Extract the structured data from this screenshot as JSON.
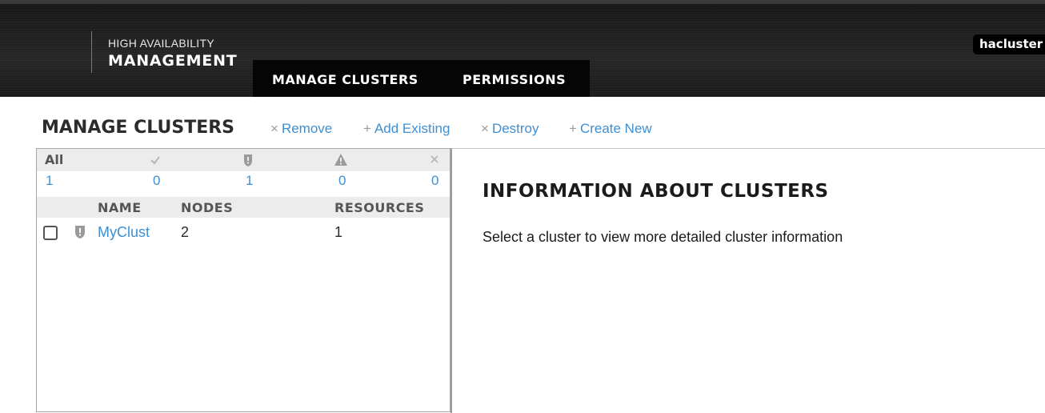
{
  "header": {
    "brand_line1": "HIGH AVAILABILITY",
    "brand_line2": "MANAGEMENT",
    "nav_tabs": [
      {
        "label": "MANAGE CLUSTERS",
        "active": true
      },
      {
        "label": "PERMISSIONS",
        "active": false
      }
    ],
    "user": "hacluster"
  },
  "toolbar": {
    "title": "MANAGE CLUSTERS",
    "actions": [
      {
        "label": "Remove",
        "glyph": "×",
        "icon": "remove-icon"
      },
      {
        "label": "Add Existing",
        "glyph": "+",
        "icon": "plus-icon"
      },
      {
        "label": "Destroy",
        "glyph": "×",
        "icon": "remove-icon"
      },
      {
        "label": "Create New",
        "glyph": "+",
        "icon": "plus-icon"
      }
    ]
  },
  "cluster_list": {
    "filters": [
      {
        "label": "All",
        "count": "1",
        "icon": null
      },
      {
        "label": "",
        "count": "0",
        "icon": "check-icon"
      },
      {
        "label": "",
        "count": "1",
        "icon": "shield-icon"
      },
      {
        "label": "",
        "count": "0",
        "icon": "warning-icon"
      },
      {
        "label": "",
        "count": "0",
        "icon": "error-x-icon"
      }
    ],
    "columns": [
      "NAME",
      "NODES",
      "RESOURCES"
    ],
    "rows": [
      {
        "status_icon": "shield-icon",
        "name": "MyClust",
        "nodes": "2",
        "resources": "1"
      }
    ]
  },
  "info_panel": {
    "title": "INFORMATION ABOUT CLUSTERS",
    "text": "Select a cluster to view more detailed cluster information"
  },
  "colors": {
    "link": "#3f8fd2",
    "header_bg": "#1e1e1e",
    "nav_bg": "#050505",
    "panel_header_bg": "#ececec",
    "muted_icon": "#9a9a9a"
  }
}
